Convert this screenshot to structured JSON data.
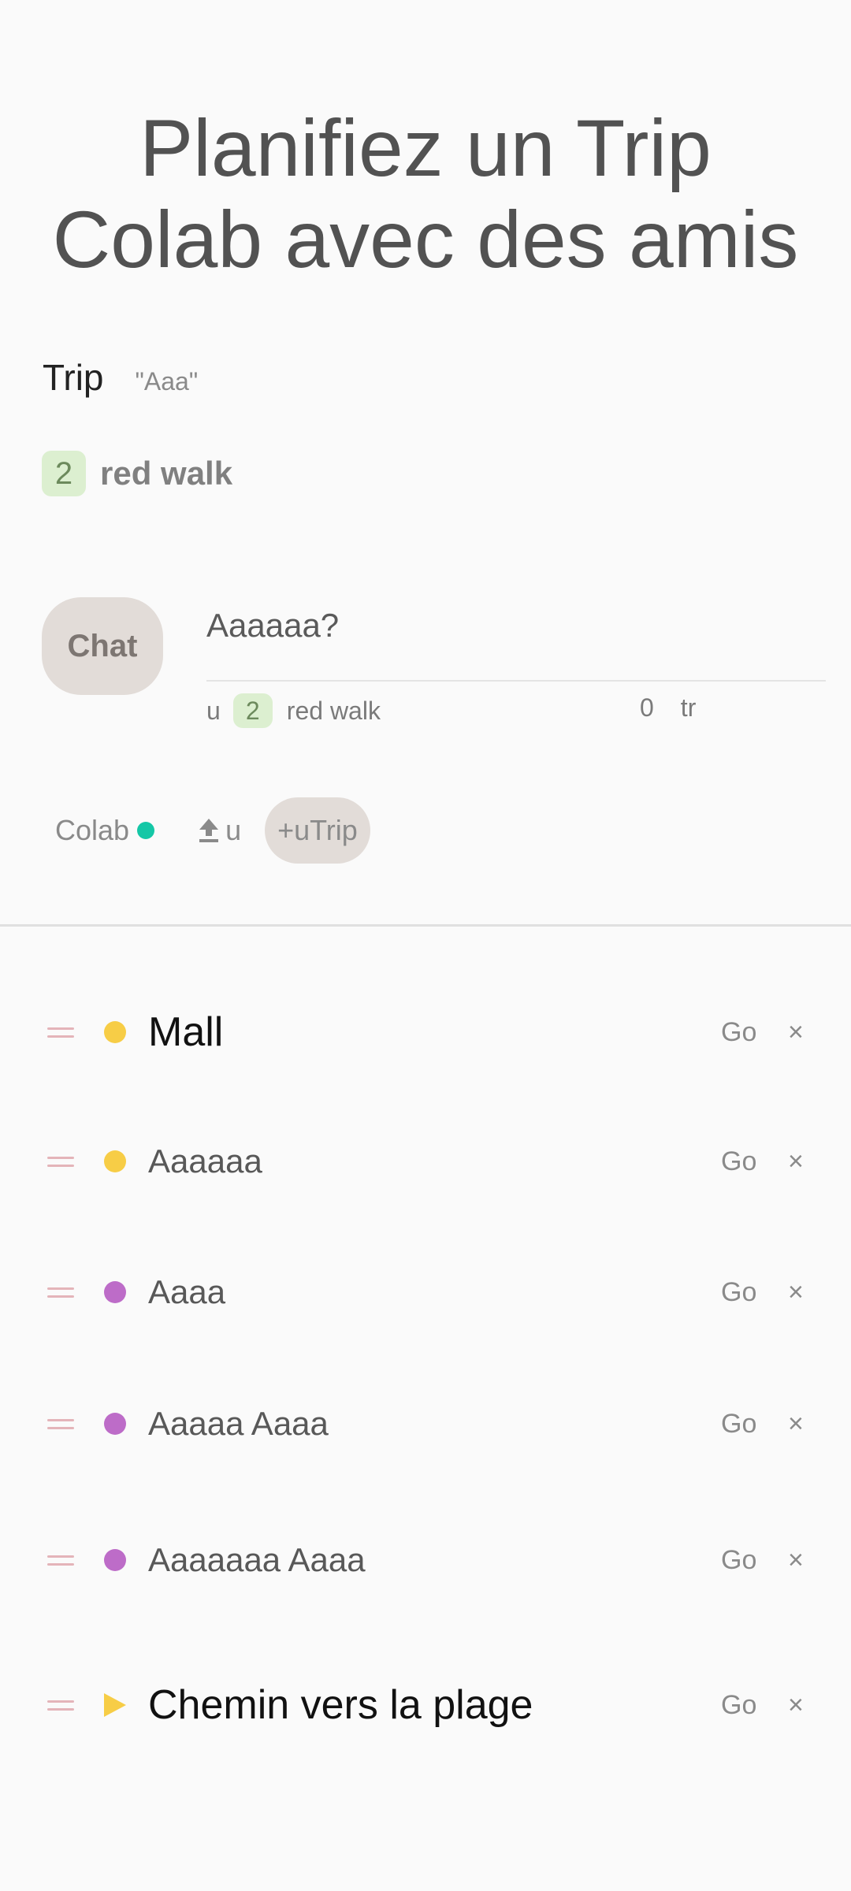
{
  "hero": {
    "line1": "Planifiez un Trip",
    "line2": "Colab avec des amis"
  },
  "trip": {
    "label": "Trip",
    "name": "\"Aaa\""
  },
  "walk": {
    "count": "2",
    "label": "red walk"
  },
  "chat": {
    "button_label": "Chat",
    "message": "Aaaaaa?",
    "meta_user": "u",
    "meta_count": "2",
    "meta_label": "red walk",
    "meta_num": "0",
    "meta_tr": "tr"
  },
  "toolbar": {
    "colab_label": "Colab",
    "status_color": "#14c7a6",
    "upload_label": "u",
    "add_trip_label": "+uTrip"
  },
  "colors": {
    "yellow": "#f7cd46",
    "purple": "#bd6cc8",
    "accent_green": "#dcefd0"
  },
  "items": [
    {
      "label": "Mall",
      "marker": "dot",
      "color": "#f7cd46",
      "go": "Go",
      "close": "×"
    },
    {
      "label": "Aaaaaa",
      "marker": "dot",
      "color": "#f7cd46",
      "go": "Go",
      "close": "×"
    },
    {
      "label": "Aaaa",
      "marker": "dot",
      "color": "#bd6cc8",
      "go": "Go",
      "close": "×"
    },
    {
      "label": "Aaaaa Aaaa",
      "marker": "dot",
      "color": "#bd6cc8",
      "go": "Go",
      "close": "×"
    },
    {
      "label": "Aaaaaaa Aaaa",
      "marker": "dot",
      "color": "#bd6cc8",
      "go": "Go",
      "close": "×"
    },
    {
      "label": "Chemin vers la plage",
      "marker": "triangle",
      "color": "#f7cd46",
      "go": "Go",
      "close": "×"
    }
  ]
}
